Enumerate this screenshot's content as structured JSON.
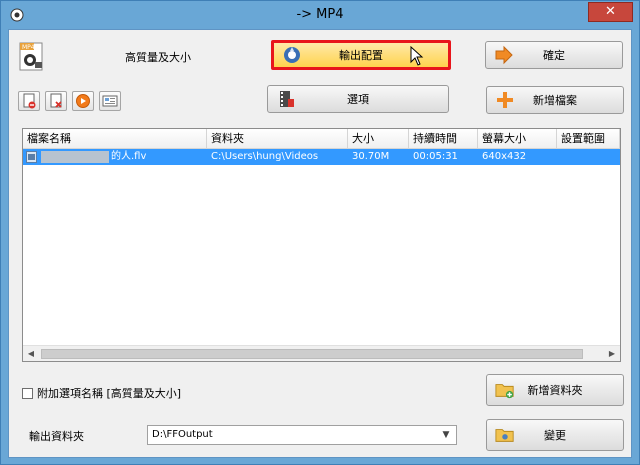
{
  "window": {
    "title": "-> MP4",
    "close_glyph": "✕"
  },
  "profile": {
    "label": "高質量及大小",
    "icon": "mp4-profile-icon"
  },
  "buttons": {
    "output_config": "輸出配置",
    "ok": "確定",
    "options": "選項",
    "add_file": "新增檔案",
    "new_folder": "新增資料夾",
    "change": "變更"
  },
  "toolbar": {
    "icons": [
      "remove-file-icon",
      "clear-list-icon",
      "play-icon",
      "media-info-icon"
    ]
  },
  "table": {
    "columns": [
      "檔案名稱",
      "資料夾",
      "大小",
      "持續時間",
      "螢幕大小",
      "設置範圍"
    ],
    "rows": [
      {
        "name": "的人.flv",
        "folder": "C:\\Users\\hung\\Videos",
        "size": "30.70M",
        "duration": "00:05:31",
        "screen": "640x432",
        "range": ""
      }
    ]
  },
  "append_option": {
    "label": "附加選項名稱 [高質量及大小]",
    "checked": false
  },
  "output_folder": {
    "label": "輸出資料夾",
    "value": "D:\\FFOutput"
  },
  "colors": {
    "highlight_border": "#e8151b",
    "selection": "#3399ff",
    "title_bar": "#69a7d6"
  }
}
